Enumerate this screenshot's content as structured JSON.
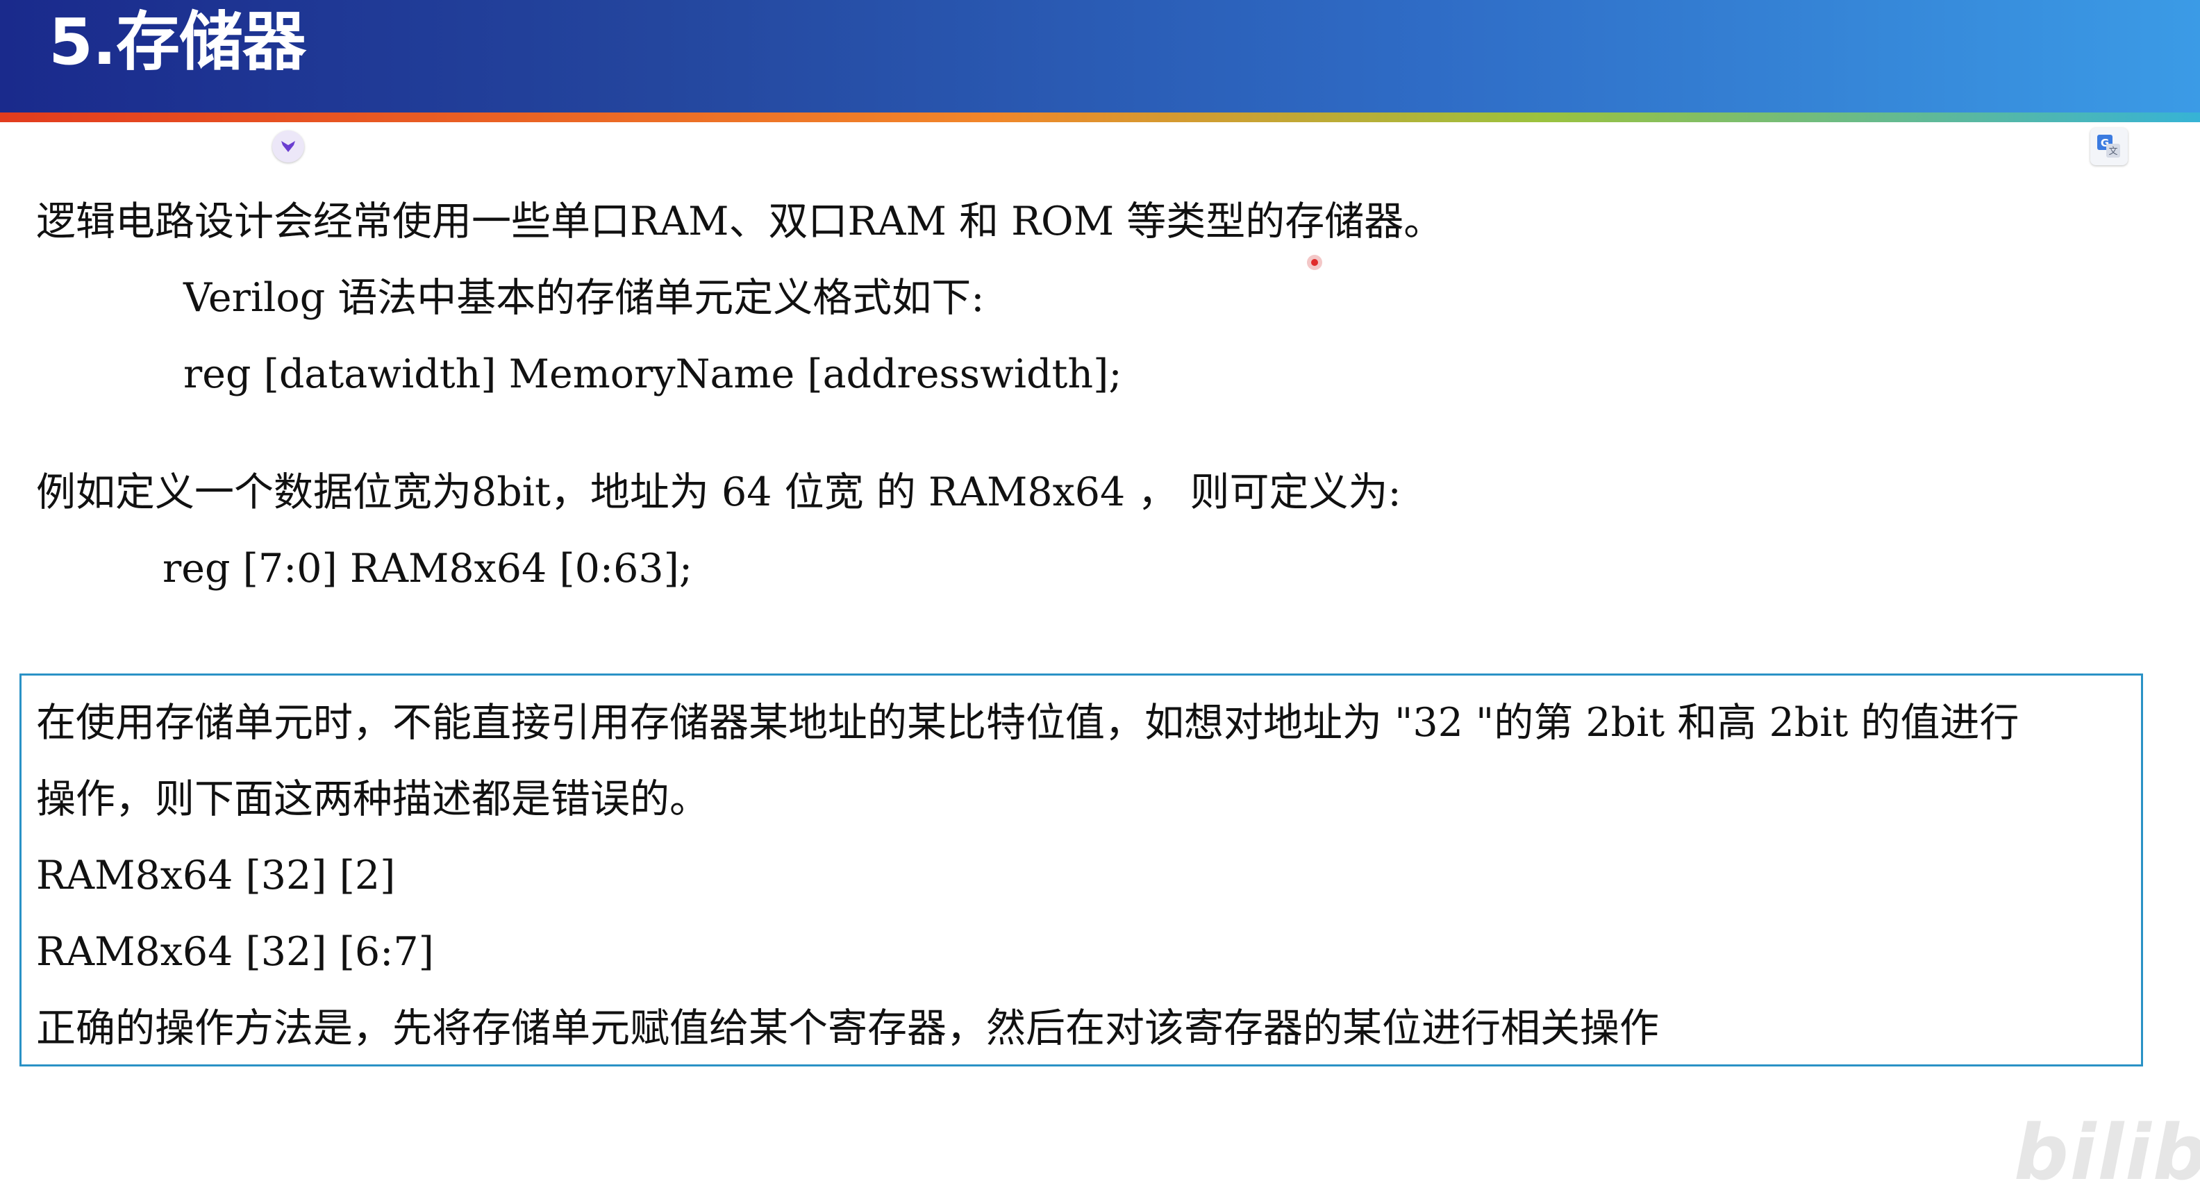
{
  "header": {
    "title": "5.存储器"
  },
  "icons": {
    "left_extension": "extension-icon",
    "right_extension": "translate-icon",
    "cursor": "cursor-pointer-icon"
  },
  "content": {
    "intro": "逻辑电路设计会经常使用一些单口RAM、双口RAM 和 ROM 等类型的存储器。",
    "syntax_label": "Verilog 语法中基本的存储单元定义格式如下:",
    "syntax_code": "reg [datawidth] MemoryName [addresswidth];",
    "example_label": "例如定义一个数据位宽为8bit，地址为 64 位宽 的 RAM8x64 ， 则可定义为:",
    "example_code": "reg [7:0] RAM8x64 [0:63];"
  },
  "note_box": {
    "line1": "在使用存储单元时，不能直接引用存储器某地址的某比特位值，如想对地址为 \"32 \"的第 2bit 和高 2bit 的值进行",
    "line2": "操作，则下面这两种描述都是错误的。",
    "wrong1": "RAM8x64 [32] [2]",
    "wrong2": "RAM8x64 [32] [6:7]",
    "correct": "正确的操作方法是，先将存储单元赋值给某个寄存器，然后在对该寄存器的某位进行相关操作"
  },
  "watermark": "bilibili",
  "colors": {
    "header_start": "#1a2a8c",
    "header_end": "#3b9be6",
    "box_border": "#2a92c6",
    "cursor": "#e02a2a"
  }
}
